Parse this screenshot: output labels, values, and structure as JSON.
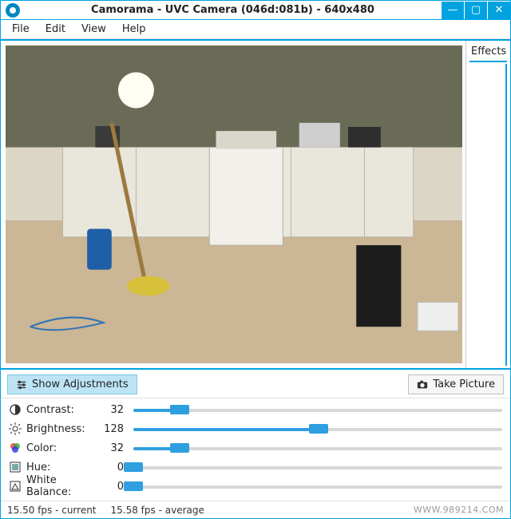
{
  "window": {
    "title": "Camorama - UVC Camera (046d:081b) - 640x480"
  },
  "menu": {
    "file": "File",
    "edit": "Edit",
    "view": "View",
    "help": "Help"
  },
  "effects": {
    "header": "Effects"
  },
  "buttons": {
    "show_adjustments": "Show Adjustments",
    "take_picture": "Take Picture"
  },
  "adjust": {
    "contrast": {
      "label": "Contrast:",
      "value": 32,
      "min": 0,
      "max": 255
    },
    "brightness": {
      "label": "Brightness:",
      "value": 128,
      "min": 0,
      "max": 255
    },
    "color": {
      "label": "Color:",
      "value": 32,
      "min": 0,
      "max": 255
    },
    "hue": {
      "label": "Hue:",
      "value": 0,
      "min": 0,
      "max": 255
    },
    "wb": {
      "label": "White Balance:",
      "value": 0,
      "min": 0,
      "max": 255
    }
  },
  "status": {
    "current": "15.50 fps - current",
    "average": "15.58 fps - average",
    "watermark": "WWW.989214.COM"
  },
  "colors": {
    "accent": "#00a3e0"
  }
}
